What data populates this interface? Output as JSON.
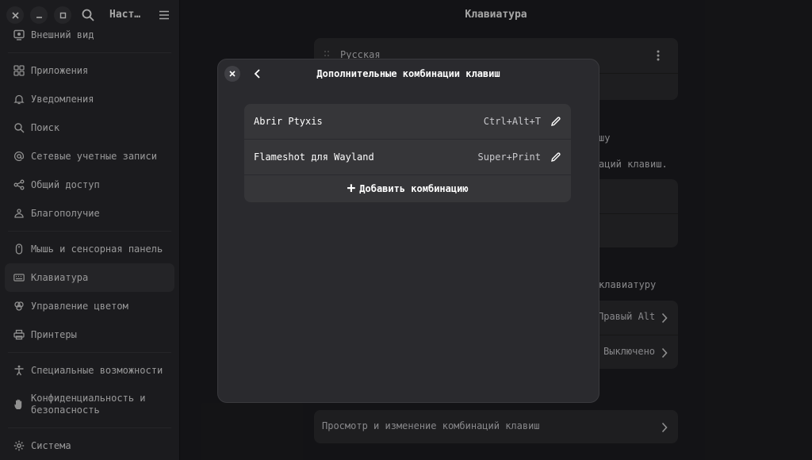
{
  "header": {
    "sidebar_title": "Наст…",
    "page_title": "Клавиатура"
  },
  "sidebar": {
    "items": [
      {
        "label": "Внешний вид",
        "icon": "display-icon"
      },
      {
        "label": "Приложения",
        "icon": "apps-grid-icon"
      },
      {
        "label": "Уведомления",
        "icon": "bell-icon"
      },
      {
        "label": "Поиск",
        "icon": "search-icon"
      },
      {
        "label": "Сетевые учетные записи",
        "icon": "at-icon"
      },
      {
        "label": "Общий доступ",
        "icon": "share-icon"
      },
      {
        "label": "Благополучие",
        "icon": "wellbeing-icon"
      },
      {
        "label": "Мышь и сенсорная панель",
        "icon": "mouse-icon"
      },
      {
        "label": "Клавиатура",
        "icon": "keyboard-icon",
        "active": true
      },
      {
        "label": "Управление цветом",
        "icon": "color-icon"
      },
      {
        "label": "Принтеры",
        "icon": "printer-icon"
      },
      {
        "label": "Специальные возможности",
        "icon": "accessibility-icon"
      },
      {
        "label": "Конфиденциальность и безопасность",
        "icon": "hand-icon"
      },
      {
        "label": "Система",
        "icon": "gear-icon"
      }
    ]
  },
  "background": {
    "layout_source": "Русская",
    "text_snippet_1": "шу",
    "text_snippet_2": "аций клавиш.",
    "text_snippet_3": "клавиатуру",
    "alt_char_value": "Правый Alt",
    "compose_value": "Выключено",
    "shortcuts_link": "Просмотр и изменение комбинаций клавиш"
  },
  "dialog": {
    "title": "Дополнительные комбинации клавиш",
    "shortcuts": [
      {
        "name": "Abrir Ptyxis",
        "accel": "Ctrl+Alt+T"
      },
      {
        "name": "Flameshot для Wayland",
        "accel": "Super+Print"
      }
    ],
    "add_label": "Добавить комбинацию"
  }
}
